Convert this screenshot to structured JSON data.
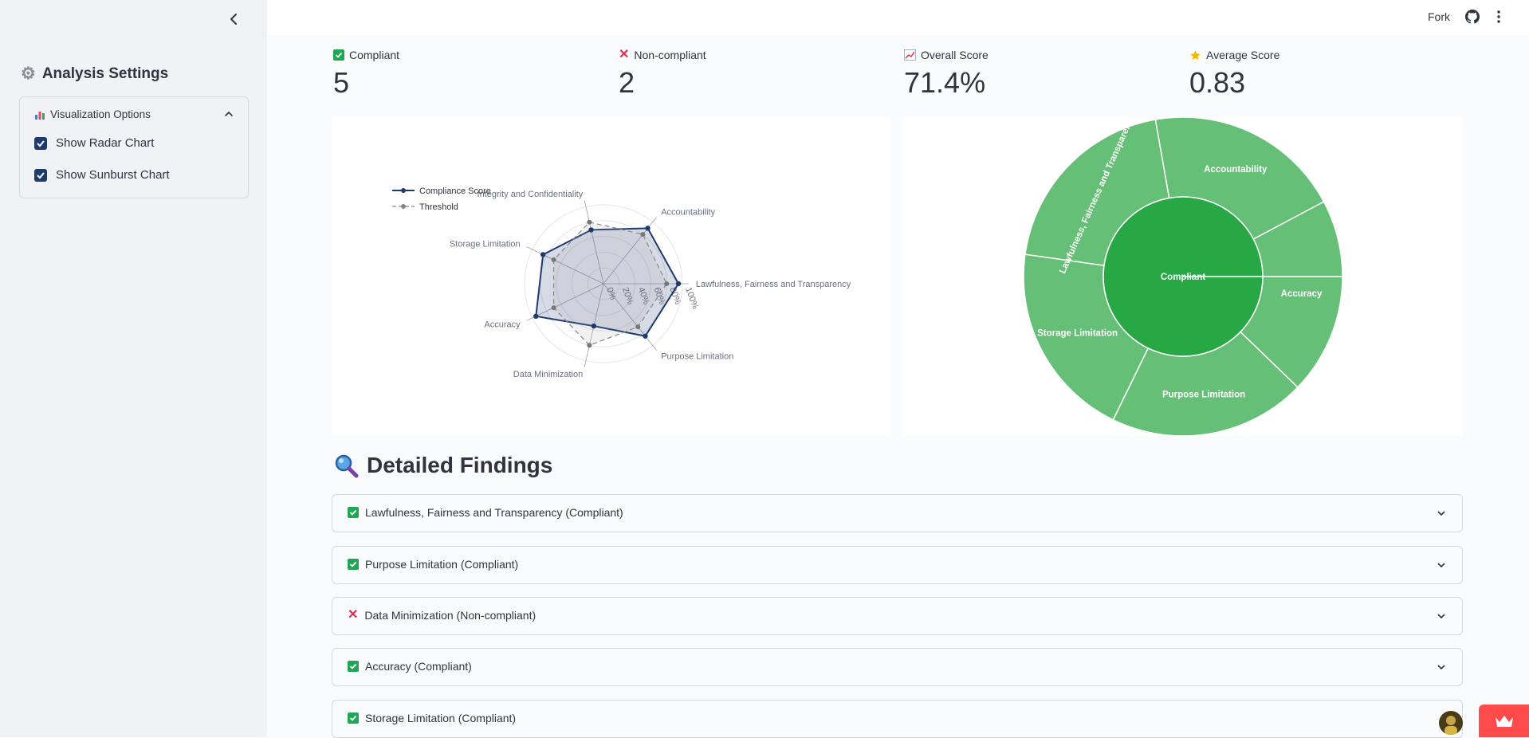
{
  "sidebar": {
    "title": "Analysis Settings",
    "title_icon": "gear-icon",
    "expander": {
      "label": "Visualization Options",
      "icon": "bar-chart-icon",
      "options": [
        {
          "label": "Show Radar Chart",
          "checked": true
        },
        {
          "label": "Show Sunburst Chart",
          "checked": true
        }
      ]
    }
  },
  "header": {
    "fork_label": "Fork"
  },
  "metrics": [
    {
      "label": "Compliant",
      "value": "5",
      "icon": "check-icon"
    },
    {
      "label": "Non-compliant",
      "value": "2",
      "icon": "cross-icon"
    },
    {
      "label": "Overall Score",
      "value": "71.4%",
      "icon": "chart-increasing-icon"
    },
    {
      "label": "Average Score",
      "value": "0.83",
      "icon": "star-icon"
    }
  ],
  "chart_data": [
    {
      "type": "radar",
      "categories": [
        "Lawfulness, Fairness and Transparency",
        "Purpose Limitation",
        "Data Minimization",
        "Accuracy",
        "Storage Limitation",
        "Integrity and Confidentiality",
        "Accountability"
      ],
      "series": [
        {
          "name": "Compliance Score",
          "values": [
            0.95,
            0.85,
            0.55,
            0.95,
            0.85,
            0.7,
            0.9
          ],
          "color": "#1f3a6e"
        },
        {
          "name": "Threshold",
          "values": [
            0.8,
            0.7,
            0.8,
            0.7,
            0.7,
            0.8,
            0.8
          ],
          "color": "#888888"
        }
      ],
      "radial_ticks": [
        "0%",
        "20%",
        "40%",
        "60%",
        "80%",
        "100%"
      ],
      "range": [
        0,
        1
      ],
      "legend": "top-left"
    },
    {
      "type": "sunburst",
      "center": "Compliant",
      "children": [
        {
          "label": "Accountability",
          "value": 1
        },
        {
          "label": "Accuracy",
          "value": 1
        },
        {
          "label": "Purpose Limitation",
          "value": 1
        },
        {
          "label": "Storage Limitation",
          "value": 1
        },
        {
          "label": "Lawfulness, Fairness and Transparency",
          "value": 1
        }
      ],
      "colors": {
        "center": "#27a844",
        "ring": "#66bf76"
      }
    }
  ],
  "findings": {
    "title": "Detailed Findings",
    "title_icon": "magnifier-icon",
    "items": [
      {
        "label": "Lawfulness, Fairness and Transparency (Compliant)",
        "status": "compliant"
      },
      {
        "label": "Purpose Limitation (Compliant)",
        "status": "compliant"
      },
      {
        "label": "Data Minimization (Non-compliant)",
        "status": "non-compliant"
      },
      {
        "label": "Accuracy (Compliant)",
        "status": "compliant"
      },
      {
        "label": "Storage Limitation (Compliant)",
        "status": "compliant"
      }
    ]
  }
}
